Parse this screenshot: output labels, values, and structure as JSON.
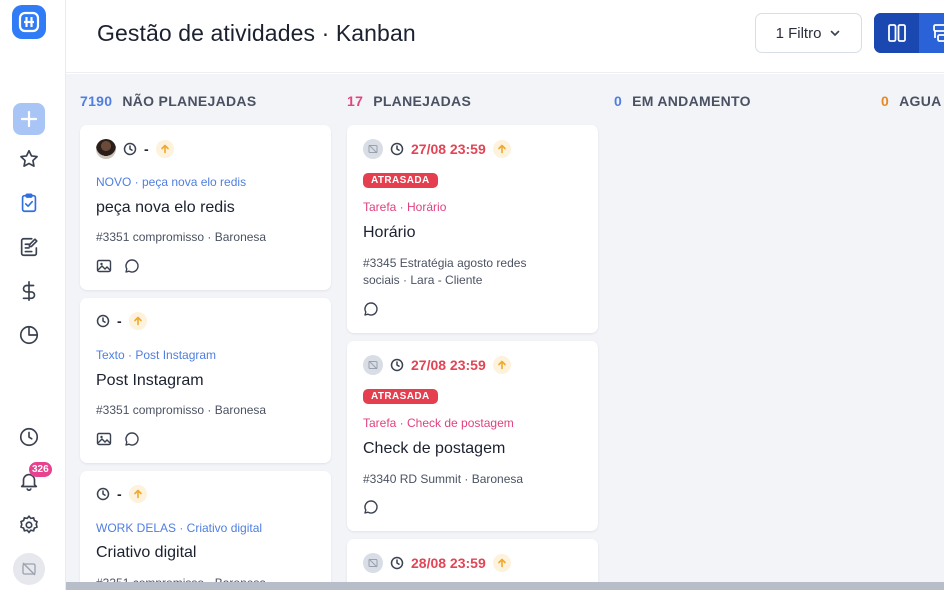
{
  "header": {
    "title": "Gestão de atividades · Kanban",
    "filter_label": "1 Filtro"
  },
  "sidebar": {
    "notification_count": "326"
  },
  "columns": [
    {
      "count": "7190",
      "title": "NÃO PLANEJADAS",
      "count_color": "#4f7ee0",
      "cards": [
        {
          "due": "-",
          "meta": "NOVO · peça nova elo redis",
          "title": "peça nova elo redis",
          "info": "#3351 compromisso  ·  Baronesa"
        },
        {
          "due": "-",
          "meta": "Texto · Post Instagram",
          "title": "Post Instagram",
          "info": "#3351 compromisso  ·  Baronesa"
        },
        {
          "due": "-",
          "meta": "WORK DELAS · Criativo digital",
          "title": "Criativo digital",
          "info": "#3351 compromisso  ·  Baronesa"
        }
      ]
    },
    {
      "count": "17",
      "title": "PLANEJADAS",
      "count_color": "#e2457e",
      "cards": [
        {
          "due": "27/08 23:59",
          "status": "ATRASADA",
          "meta": "Tarefa · Horário",
          "title": "Horário",
          "info": "#3345 Estratégia agosto redes sociais  ·  Lara - Cliente"
        },
        {
          "due": "27/08 23:59",
          "status": "ATRASADA",
          "meta": "Tarefa · Check de postagem",
          "title": "Check de postagem",
          "info": "#3340 RD Summit  ·  Baronesa"
        },
        {
          "due": "28/08 23:59"
        }
      ]
    },
    {
      "count": "0",
      "title": "EM ANDAMENTO",
      "count_color": "#4f7ee0",
      "cards": []
    },
    {
      "count": "0",
      "title": "AGUA",
      "count_color": "#e68a24",
      "cards": []
    }
  ],
  "colors": {
    "primary": "#1f55c8",
    "late": "#e24556",
    "priority": "#f0a830"
  }
}
